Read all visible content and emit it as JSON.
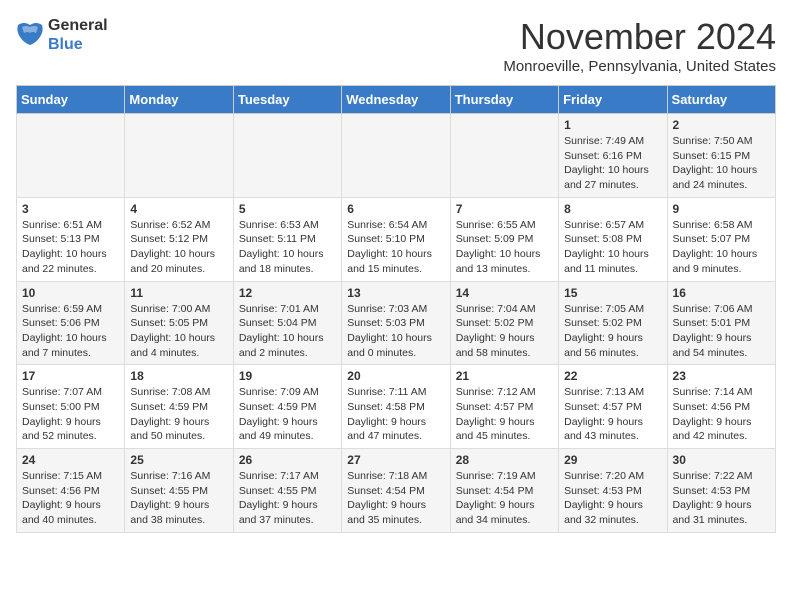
{
  "logo": {
    "general": "General",
    "blue": "Blue"
  },
  "header": {
    "month": "November 2024",
    "location": "Monroeville, Pennsylvania, United States"
  },
  "weekdays": [
    "Sunday",
    "Monday",
    "Tuesday",
    "Wednesday",
    "Thursday",
    "Friday",
    "Saturday"
  ],
  "weeks": [
    [
      {
        "day": "",
        "info": ""
      },
      {
        "day": "",
        "info": ""
      },
      {
        "day": "",
        "info": ""
      },
      {
        "day": "",
        "info": ""
      },
      {
        "day": "",
        "info": ""
      },
      {
        "day": "1",
        "info": "Sunrise: 7:49 AM\nSunset: 6:16 PM\nDaylight: 10 hours and 27 minutes."
      },
      {
        "day": "2",
        "info": "Sunrise: 7:50 AM\nSunset: 6:15 PM\nDaylight: 10 hours and 24 minutes."
      }
    ],
    [
      {
        "day": "3",
        "info": "Sunrise: 6:51 AM\nSunset: 5:13 PM\nDaylight: 10 hours and 22 minutes."
      },
      {
        "day": "4",
        "info": "Sunrise: 6:52 AM\nSunset: 5:12 PM\nDaylight: 10 hours and 20 minutes."
      },
      {
        "day": "5",
        "info": "Sunrise: 6:53 AM\nSunset: 5:11 PM\nDaylight: 10 hours and 18 minutes."
      },
      {
        "day": "6",
        "info": "Sunrise: 6:54 AM\nSunset: 5:10 PM\nDaylight: 10 hours and 15 minutes."
      },
      {
        "day": "7",
        "info": "Sunrise: 6:55 AM\nSunset: 5:09 PM\nDaylight: 10 hours and 13 minutes."
      },
      {
        "day": "8",
        "info": "Sunrise: 6:57 AM\nSunset: 5:08 PM\nDaylight: 10 hours and 11 minutes."
      },
      {
        "day": "9",
        "info": "Sunrise: 6:58 AM\nSunset: 5:07 PM\nDaylight: 10 hours and 9 minutes."
      }
    ],
    [
      {
        "day": "10",
        "info": "Sunrise: 6:59 AM\nSunset: 5:06 PM\nDaylight: 10 hours and 7 minutes."
      },
      {
        "day": "11",
        "info": "Sunrise: 7:00 AM\nSunset: 5:05 PM\nDaylight: 10 hours and 4 minutes."
      },
      {
        "day": "12",
        "info": "Sunrise: 7:01 AM\nSunset: 5:04 PM\nDaylight: 10 hours and 2 minutes."
      },
      {
        "day": "13",
        "info": "Sunrise: 7:03 AM\nSunset: 5:03 PM\nDaylight: 10 hours and 0 minutes."
      },
      {
        "day": "14",
        "info": "Sunrise: 7:04 AM\nSunset: 5:02 PM\nDaylight: 9 hours and 58 minutes."
      },
      {
        "day": "15",
        "info": "Sunrise: 7:05 AM\nSunset: 5:02 PM\nDaylight: 9 hours and 56 minutes."
      },
      {
        "day": "16",
        "info": "Sunrise: 7:06 AM\nSunset: 5:01 PM\nDaylight: 9 hours and 54 minutes."
      }
    ],
    [
      {
        "day": "17",
        "info": "Sunrise: 7:07 AM\nSunset: 5:00 PM\nDaylight: 9 hours and 52 minutes."
      },
      {
        "day": "18",
        "info": "Sunrise: 7:08 AM\nSunset: 4:59 PM\nDaylight: 9 hours and 50 minutes."
      },
      {
        "day": "19",
        "info": "Sunrise: 7:09 AM\nSunset: 4:59 PM\nDaylight: 9 hours and 49 minutes."
      },
      {
        "day": "20",
        "info": "Sunrise: 7:11 AM\nSunset: 4:58 PM\nDaylight: 9 hours and 47 minutes."
      },
      {
        "day": "21",
        "info": "Sunrise: 7:12 AM\nSunset: 4:57 PM\nDaylight: 9 hours and 45 minutes."
      },
      {
        "day": "22",
        "info": "Sunrise: 7:13 AM\nSunset: 4:57 PM\nDaylight: 9 hours and 43 minutes."
      },
      {
        "day": "23",
        "info": "Sunrise: 7:14 AM\nSunset: 4:56 PM\nDaylight: 9 hours and 42 minutes."
      }
    ],
    [
      {
        "day": "24",
        "info": "Sunrise: 7:15 AM\nSunset: 4:56 PM\nDaylight: 9 hours and 40 minutes."
      },
      {
        "day": "25",
        "info": "Sunrise: 7:16 AM\nSunset: 4:55 PM\nDaylight: 9 hours and 38 minutes."
      },
      {
        "day": "26",
        "info": "Sunrise: 7:17 AM\nSunset: 4:55 PM\nDaylight: 9 hours and 37 minutes."
      },
      {
        "day": "27",
        "info": "Sunrise: 7:18 AM\nSunset: 4:54 PM\nDaylight: 9 hours and 35 minutes."
      },
      {
        "day": "28",
        "info": "Sunrise: 7:19 AM\nSunset: 4:54 PM\nDaylight: 9 hours and 34 minutes."
      },
      {
        "day": "29",
        "info": "Sunrise: 7:20 AM\nSunset: 4:53 PM\nDaylight: 9 hours and 32 minutes."
      },
      {
        "day": "30",
        "info": "Sunrise: 7:22 AM\nSunset: 4:53 PM\nDaylight: 9 hours and 31 minutes."
      }
    ]
  ]
}
